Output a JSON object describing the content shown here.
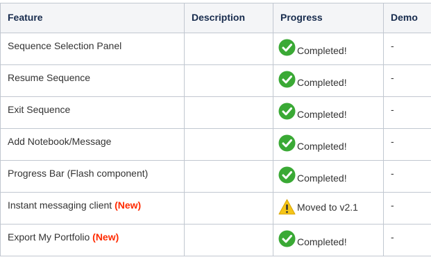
{
  "table": {
    "headers": [
      "Feature",
      "Description",
      "Progress",
      "Demo"
    ],
    "rows": [
      {
        "feature": "Sequence Selection Panel",
        "new": "",
        "description": "",
        "progress": "Completed!",
        "status": "ok",
        "demo": "-"
      },
      {
        "feature": "Resume Sequence",
        "new": "",
        "description": "",
        "progress": "Completed!",
        "status": "ok",
        "demo": "-"
      },
      {
        "feature": "Exit Sequence",
        "new": "",
        "description": "",
        "progress": "Completed!",
        "status": "ok",
        "demo": "-"
      },
      {
        "feature": "Add Notebook/Message",
        "new": "",
        "description": "",
        "progress": "Completed!",
        "status": "ok",
        "demo": "-"
      },
      {
        "feature": "Progress Bar (Flash component)",
        "new": "",
        "description": "",
        "progress": "Completed!",
        "status": "ok",
        "demo": "-"
      },
      {
        "feature": "Instant messaging client",
        "new": "(New)",
        "description": "",
        "progress": "Moved to v2.1",
        "status": "warning",
        "demo": "-"
      },
      {
        "feature": "Export My Portfolio",
        "new": "(New)",
        "description": "",
        "progress": "Completed!",
        "status": "ok",
        "demo": "-"
      }
    ]
  },
  "icons": {
    "ok": "check-circle-icon",
    "warning": "warning-icon"
  },
  "colors": {
    "ok": "#3aa935",
    "warning": "#f5c518",
    "new_label": "#ff2a00",
    "header_bg": "#f4f5f7",
    "border": "#c1c7d0"
  }
}
